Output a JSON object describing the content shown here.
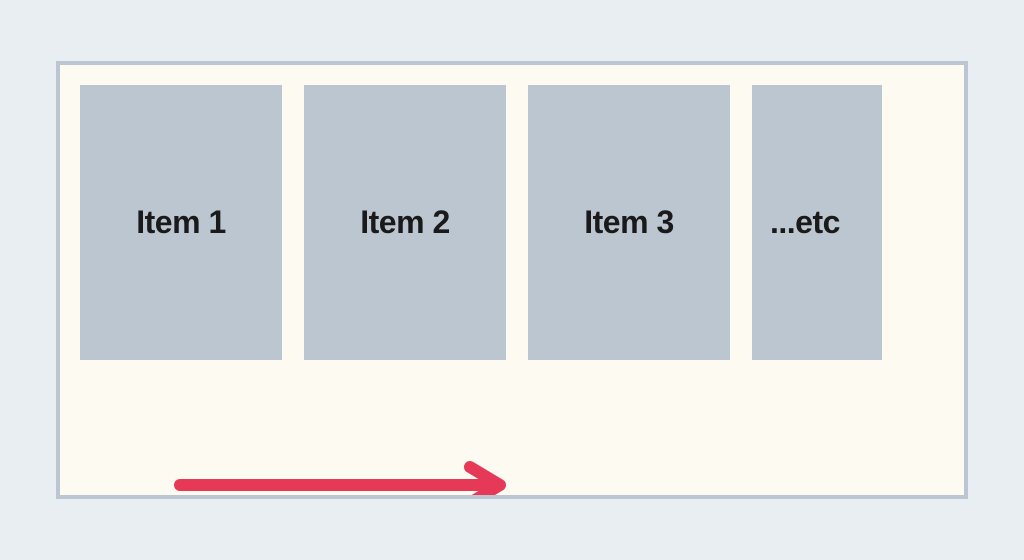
{
  "items": [
    {
      "label": "Item 1"
    },
    {
      "label": "Item 2"
    },
    {
      "label": "Item 3"
    },
    {
      "label": "...etc"
    }
  ],
  "arrow": {
    "color": "#e63857",
    "direction": "right"
  },
  "colors": {
    "page_bg": "#e9eef2",
    "container_bg": "#fdfaf2",
    "card_bg": "#bbc6d0",
    "border": "#bbc6d0",
    "text": "#1a1a1a"
  }
}
